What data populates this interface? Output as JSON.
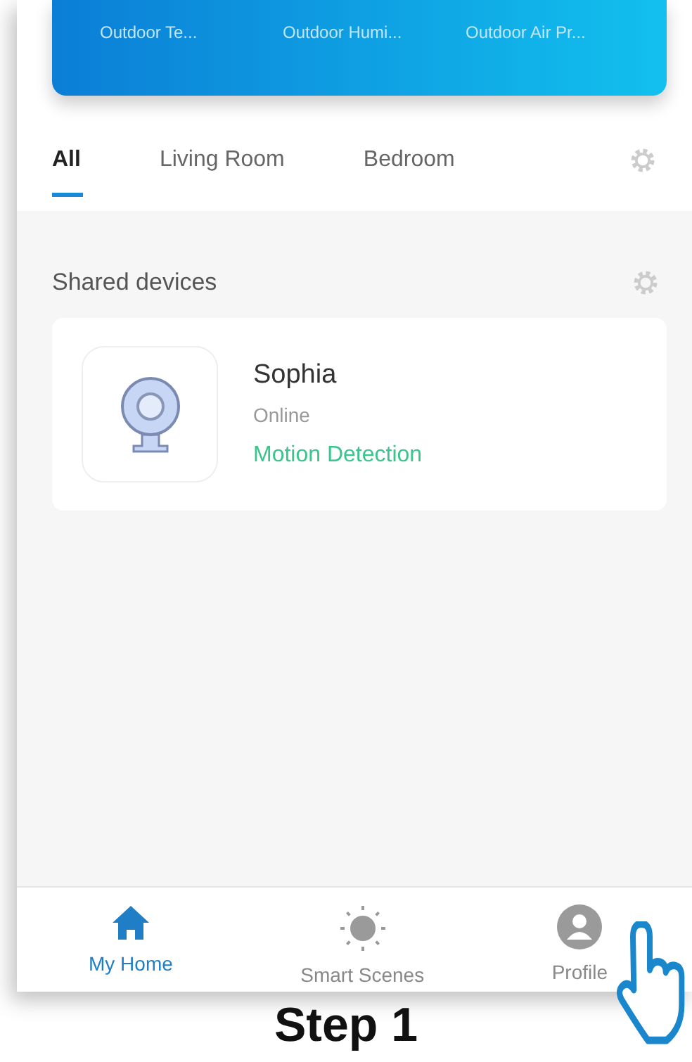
{
  "weather_card": {
    "readings": [
      {
        "label": "Outdoor Te..."
      },
      {
        "label": "Outdoor Humi..."
      },
      {
        "label": "Outdoor Air Pr..."
      }
    ]
  },
  "tabs": [
    {
      "label": "All",
      "selected": true
    },
    {
      "label": "Living Room",
      "selected": false
    },
    {
      "label": "Bedroom",
      "selected": false
    }
  ],
  "section": {
    "title": "Shared devices"
  },
  "devices": [
    {
      "name": "Sophia",
      "status": "Online",
      "feature": "Motion Detection"
    }
  ],
  "bottom_nav": [
    {
      "label": "My Home",
      "selected": true
    },
    {
      "label": "Smart Scenes",
      "selected": false
    },
    {
      "label": "Profile",
      "selected": false
    }
  ],
  "caption": "Step 1"
}
